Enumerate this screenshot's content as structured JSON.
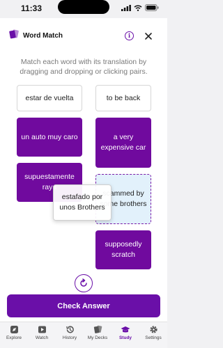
{
  "status_bar": {
    "time": "11:33"
  },
  "header": {
    "title": "Word Match",
    "info_label": "i"
  },
  "instructions": "Match each word with its translation by dragging and dropping or clicking pairs.",
  "cards": {
    "left": [
      "estar de vuelta",
      "un auto muy caro",
      "supuestamente raya"
    ],
    "right": [
      "to be back",
      "a very expensive car",
      "scammed by some brothers",
      "supposedly scratch"
    ],
    "dragging": "estafado por unos Brothers"
  },
  "check_button": "Check Answer",
  "tabs": [
    {
      "label": "Explore",
      "icon": "compass-icon"
    },
    {
      "label": "Watch",
      "icon": "play-icon"
    },
    {
      "label": "History",
      "icon": "history-icon"
    },
    {
      "label": "My Decks",
      "icon": "decks-icon"
    },
    {
      "label": "Study",
      "icon": "graduation-cap-icon",
      "active": true
    },
    {
      "label": "Settings",
      "icon": "gear-icon"
    }
  ],
  "colors": {
    "accent": "#6a0fa8",
    "card_purple": "#700a9e",
    "target_bg": "#e2f1fb"
  }
}
